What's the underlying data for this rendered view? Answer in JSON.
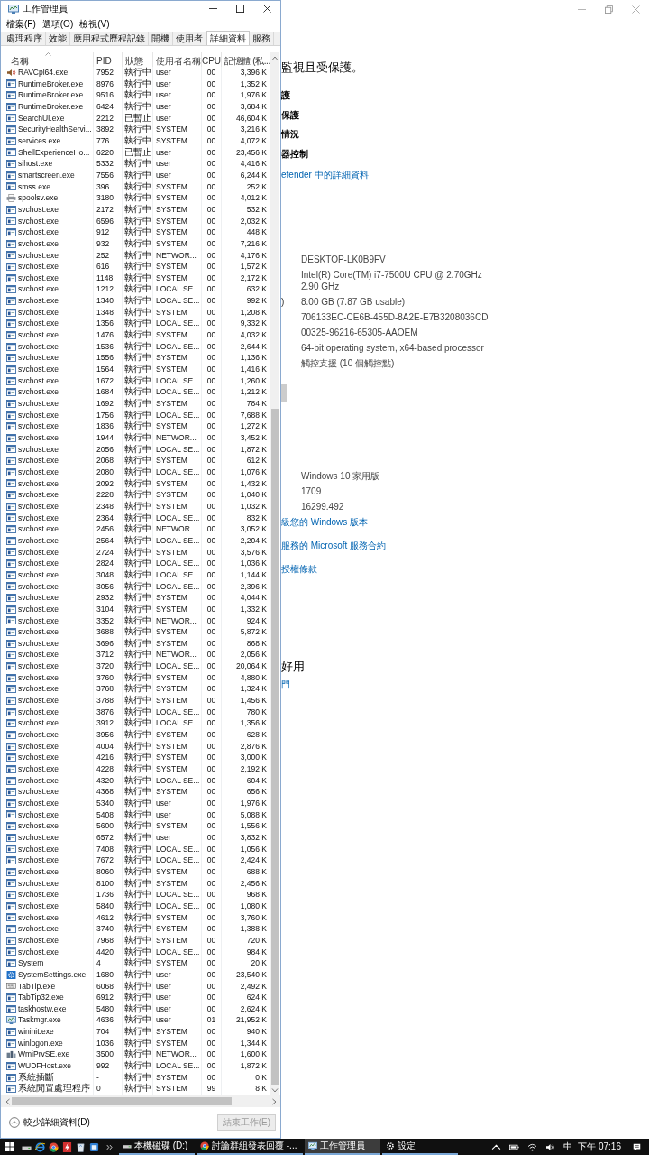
{
  "task_manager": {
    "title": "工作管理員",
    "menu": [
      "檔案(F)",
      "選項(O)",
      "檢視(V)"
    ],
    "tabs": [
      {
        "label": "處理程序",
        "selected": false
      },
      {
        "label": "效能",
        "selected": false
      },
      {
        "label": "應用程式歷程記錄",
        "selected": false
      },
      {
        "label": "開機",
        "selected": false
      },
      {
        "label": "使用者",
        "selected": false
      },
      {
        "label": "詳細資料",
        "selected": true
      },
      {
        "label": "服務",
        "selected": false
      }
    ],
    "columns": [
      "名稱",
      "PID",
      "狀態",
      "使用者名稱",
      "CPU",
      "記憶體 (私..."
    ],
    "rows": [
      {
        "kind": "audio",
        "name": "RAVCpl64.exe",
        "pid": "7952",
        "status": "執行中",
        "user": "user",
        "cpu": "00",
        "memory": "3,396 K"
      },
      {
        "kind": "app",
        "name": "RuntimeBroker.exe",
        "pid": "8976",
        "status": "執行中",
        "user": "user",
        "cpu": "00",
        "memory": "1,352 K"
      },
      {
        "kind": "app",
        "name": "RuntimeBroker.exe",
        "pid": "9516",
        "status": "執行中",
        "user": "user",
        "cpu": "00",
        "memory": "1,976 K"
      },
      {
        "kind": "app",
        "name": "RuntimeBroker.exe",
        "pid": "6424",
        "status": "執行中",
        "user": "user",
        "cpu": "00",
        "memory": "3,684 K"
      },
      {
        "kind": "app",
        "name": "SearchUI.exe",
        "pid": "2212",
        "status": "已暫止",
        "user": "user",
        "cpu": "00",
        "memory": "46,604 K"
      },
      {
        "kind": "app",
        "name": "SecurityHealthServi...",
        "pid": "3892",
        "status": "執行中",
        "user": "SYSTEM",
        "cpu": "00",
        "memory": "3,216 K"
      },
      {
        "kind": "app",
        "name": "services.exe",
        "pid": "776",
        "status": "執行中",
        "user": "SYSTEM",
        "cpu": "00",
        "memory": "4,072 K"
      },
      {
        "kind": "app",
        "name": "ShellExperienceHo...",
        "pid": "6220",
        "status": "已暫止",
        "user": "user",
        "cpu": "00",
        "memory": "23,456 K"
      },
      {
        "kind": "app",
        "name": "sihost.exe",
        "pid": "5332",
        "status": "執行中",
        "user": "user",
        "cpu": "00",
        "memory": "4,416 K"
      },
      {
        "kind": "app",
        "name": "smartscreen.exe",
        "pid": "7556",
        "status": "執行中",
        "user": "user",
        "cpu": "00",
        "memory": "6,244 K"
      },
      {
        "kind": "app",
        "name": "smss.exe",
        "pid": "396",
        "status": "執行中",
        "user": "SYSTEM",
        "cpu": "00",
        "memory": "252 K"
      },
      {
        "kind": "printer",
        "name": "spoolsv.exe",
        "pid": "3180",
        "status": "執行中",
        "user": "SYSTEM",
        "cpu": "00",
        "memory": "4,012 K"
      },
      {
        "kind": "app",
        "name": "svchost.exe",
        "pid": "2172",
        "status": "執行中",
        "user": "SYSTEM",
        "cpu": "00",
        "memory": "532 K"
      },
      {
        "kind": "app",
        "name": "svchost.exe",
        "pid": "6596",
        "status": "執行中",
        "user": "SYSTEM",
        "cpu": "00",
        "memory": "2,032 K"
      },
      {
        "kind": "app",
        "name": "svchost.exe",
        "pid": "912",
        "status": "執行中",
        "user": "SYSTEM",
        "cpu": "00",
        "memory": "448 K"
      },
      {
        "kind": "app",
        "name": "svchost.exe",
        "pid": "932",
        "status": "執行中",
        "user": "SYSTEM",
        "cpu": "00",
        "memory": "7,216 K"
      },
      {
        "kind": "app",
        "name": "svchost.exe",
        "pid": "252",
        "status": "執行中",
        "user": "NETWOR...",
        "cpu": "00",
        "memory": "4,176 K"
      },
      {
        "kind": "app",
        "name": "svchost.exe",
        "pid": "616",
        "status": "執行中",
        "user": "SYSTEM",
        "cpu": "00",
        "memory": "1,572 K"
      },
      {
        "kind": "app",
        "name": "svchost.exe",
        "pid": "1148",
        "status": "執行中",
        "user": "SYSTEM",
        "cpu": "00",
        "memory": "2,172 K"
      },
      {
        "kind": "app",
        "name": "svchost.exe",
        "pid": "1212",
        "status": "執行中",
        "user": "LOCAL SE...",
        "cpu": "00",
        "memory": "632 K"
      },
      {
        "kind": "app",
        "name": "svchost.exe",
        "pid": "1340",
        "status": "執行中",
        "user": "LOCAL SE...",
        "cpu": "00",
        "memory": "992 K"
      },
      {
        "kind": "app",
        "name": "svchost.exe",
        "pid": "1348",
        "status": "執行中",
        "user": "SYSTEM",
        "cpu": "00",
        "memory": "1,208 K"
      },
      {
        "kind": "app",
        "name": "svchost.exe",
        "pid": "1356",
        "status": "執行中",
        "user": "LOCAL SE...",
        "cpu": "00",
        "memory": "9,332 K"
      },
      {
        "kind": "app",
        "name": "svchost.exe",
        "pid": "1476",
        "status": "執行中",
        "user": "SYSTEM",
        "cpu": "00",
        "memory": "4,032 K"
      },
      {
        "kind": "app",
        "name": "svchost.exe",
        "pid": "1536",
        "status": "執行中",
        "user": "LOCAL SE...",
        "cpu": "00",
        "memory": "2,644 K"
      },
      {
        "kind": "app",
        "name": "svchost.exe",
        "pid": "1556",
        "status": "執行中",
        "user": "SYSTEM",
        "cpu": "00",
        "memory": "1,136 K"
      },
      {
        "kind": "app",
        "name": "svchost.exe",
        "pid": "1564",
        "status": "執行中",
        "user": "SYSTEM",
        "cpu": "00",
        "memory": "1,416 K"
      },
      {
        "kind": "app",
        "name": "svchost.exe",
        "pid": "1672",
        "status": "執行中",
        "user": "LOCAL SE...",
        "cpu": "00",
        "memory": "1,260 K"
      },
      {
        "kind": "app",
        "name": "svchost.exe",
        "pid": "1684",
        "status": "執行中",
        "user": "LOCAL SE...",
        "cpu": "00",
        "memory": "1,212 K"
      },
      {
        "kind": "app",
        "name": "svchost.exe",
        "pid": "1692",
        "status": "執行中",
        "user": "SYSTEM",
        "cpu": "00",
        "memory": "784 K"
      },
      {
        "kind": "app",
        "name": "svchost.exe",
        "pid": "1756",
        "status": "執行中",
        "user": "LOCAL SE...",
        "cpu": "00",
        "memory": "7,688 K"
      },
      {
        "kind": "app",
        "name": "svchost.exe",
        "pid": "1836",
        "status": "執行中",
        "user": "SYSTEM",
        "cpu": "00",
        "memory": "1,272 K"
      },
      {
        "kind": "app",
        "name": "svchost.exe",
        "pid": "1944",
        "status": "執行中",
        "user": "NETWOR...",
        "cpu": "00",
        "memory": "3,452 K"
      },
      {
        "kind": "app",
        "name": "svchost.exe",
        "pid": "2056",
        "status": "執行中",
        "user": "LOCAL SE...",
        "cpu": "00",
        "memory": "1,872 K"
      },
      {
        "kind": "app",
        "name": "svchost.exe",
        "pid": "2068",
        "status": "執行中",
        "user": "SYSTEM",
        "cpu": "00",
        "memory": "612 K"
      },
      {
        "kind": "app",
        "name": "svchost.exe",
        "pid": "2080",
        "status": "執行中",
        "user": "LOCAL SE...",
        "cpu": "00",
        "memory": "1,076 K"
      },
      {
        "kind": "app",
        "name": "svchost.exe",
        "pid": "2092",
        "status": "執行中",
        "user": "SYSTEM",
        "cpu": "00",
        "memory": "1,432 K"
      },
      {
        "kind": "app",
        "name": "svchost.exe",
        "pid": "2228",
        "status": "執行中",
        "user": "SYSTEM",
        "cpu": "00",
        "memory": "1,040 K"
      },
      {
        "kind": "app",
        "name": "svchost.exe",
        "pid": "2348",
        "status": "執行中",
        "user": "SYSTEM",
        "cpu": "00",
        "memory": "1,032 K"
      },
      {
        "kind": "app",
        "name": "svchost.exe",
        "pid": "2364",
        "status": "執行中",
        "user": "LOCAL SE...",
        "cpu": "00",
        "memory": "832 K"
      },
      {
        "kind": "app",
        "name": "svchost.exe",
        "pid": "2456",
        "status": "執行中",
        "user": "NETWOR...",
        "cpu": "00",
        "memory": "3,052 K"
      },
      {
        "kind": "app",
        "name": "svchost.exe",
        "pid": "2564",
        "status": "執行中",
        "user": "LOCAL SE...",
        "cpu": "00",
        "memory": "2,204 K"
      },
      {
        "kind": "app",
        "name": "svchost.exe",
        "pid": "2724",
        "status": "執行中",
        "user": "SYSTEM",
        "cpu": "00",
        "memory": "3,576 K"
      },
      {
        "kind": "app",
        "name": "svchost.exe",
        "pid": "2824",
        "status": "執行中",
        "user": "LOCAL SE...",
        "cpu": "00",
        "memory": "1,036 K"
      },
      {
        "kind": "app",
        "name": "svchost.exe",
        "pid": "3048",
        "status": "執行中",
        "user": "LOCAL SE...",
        "cpu": "00",
        "memory": "1,144 K"
      },
      {
        "kind": "app",
        "name": "svchost.exe",
        "pid": "3056",
        "status": "執行中",
        "user": "LOCAL SE...",
        "cpu": "00",
        "memory": "2,396 K"
      },
      {
        "kind": "app",
        "name": "svchost.exe",
        "pid": "2932",
        "status": "執行中",
        "user": "SYSTEM",
        "cpu": "00",
        "memory": "4,044 K"
      },
      {
        "kind": "app",
        "name": "svchost.exe",
        "pid": "3104",
        "status": "執行中",
        "user": "SYSTEM",
        "cpu": "00",
        "memory": "1,332 K"
      },
      {
        "kind": "app",
        "name": "svchost.exe",
        "pid": "3352",
        "status": "執行中",
        "user": "NETWOR...",
        "cpu": "00",
        "memory": "924 K"
      },
      {
        "kind": "app",
        "name": "svchost.exe",
        "pid": "3688",
        "status": "執行中",
        "user": "SYSTEM",
        "cpu": "00",
        "memory": "5,872 K"
      },
      {
        "kind": "app",
        "name": "svchost.exe",
        "pid": "3696",
        "status": "執行中",
        "user": "SYSTEM",
        "cpu": "00",
        "memory": "868 K"
      },
      {
        "kind": "app",
        "name": "svchost.exe",
        "pid": "3712",
        "status": "執行中",
        "user": "NETWOR...",
        "cpu": "00",
        "memory": "2,056 K"
      },
      {
        "kind": "app",
        "name": "svchost.exe",
        "pid": "3720",
        "status": "執行中",
        "user": "LOCAL SE...",
        "cpu": "00",
        "memory": "20,064 K"
      },
      {
        "kind": "app",
        "name": "svchost.exe",
        "pid": "3760",
        "status": "執行中",
        "user": "SYSTEM",
        "cpu": "00",
        "memory": "4,880 K"
      },
      {
        "kind": "app",
        "name": "svchost.exe",
        "pid": "3768",
        "status": "執行中",
        "user": "SYSTEM",
        "cpu": "00",
        "memory": "1,324 K"
      },
      {
        "kind": "app",
        "name": "svchost.exe",
        "pid": "3788",
        "status": "執行中",
        "user": "SYSTEM",
        "cpu": "00",
        "memory": "1,456 K"
      },
      {
        "kind": "app",
        "name": "svchost.exe",
        "pid": "3876",
        "status": "執行中",
        "user": "LOCAL SE...",
        "cpu": "00",
        "memory": "780 K"
      },
      {
        "kind": "app",
        "name": "svchost.exe",
        "pid": "3912",
        "status": "執行中",
        "user": "LOCAL SE...",
        "cpu": "00",
        "memory": "1,356 K"
      },
      {
        "kind": "app",
        "name": "svchost.exe",
        "pid": "3956",
        "status": "執行中",
        "user": "SYSTEM",
        "cpu": "00",
        "memory": "628 K"
      },
      {
        "kind": "app",
        "name": "svchost.exe",
        "pid": "4004",
        "status": "執行中",
        "user": "SYSTEM",
        "cpu": "00",
        "memory": "2,876 K"
      },
      {
        "kind": "app",
        "name": "svchost.exe",
        "pid": "4216",
        "status": "執行中",
        "user": "SYSTEM",
        "cpu": "00",
        "memory": "3,000 K"
      },
      {
        "kind": "app",
        "name": "svchost.exe",
        "pid": "4228",
        "status": "執行中",
        "user": "SYSTEM",
        "cpu": "00",
        "memory": "2,192 K"
      },
      {
        "kind": "app",
        "name": "svchost.exe",
        "pid": "4320",
        "status": "執行中",
        "user": "LOCAL SE...",
        "cpu": "00",
        "memory": "604 K"
      },
      {
        "kind": "app",
        "name": "svchost.exe",
        "pid": "4368",
        "status": "執行中",
        "user": "SYSTEM",
        "cpu": "00",
        "memory": "656 K"
      },
      {
        "kind": "app",
        "name": "svchost.exe",
        "pid": "5340",
        "status": "執行中",
        "user": "user",
        "cpu": "00",
        "memory": "1,976 K"
      },
      {
        "kind": "app",
        "name": "svchost.exe",
        "pid": "5408",
        "status": "執行中",
        "user": "user",
        "cpu": "00",
        "memory": "5,088 K"
      },
      {
        "kind": "app",
        "name": "svchost.exe",
        "pid": "5600",
        "status": "執行中",
        "user": "SYSTEM",
        "cpu": "00",
        "memory": "1,556 K"
      },
      {
        "kind": "app",
        "name": "svchost.exe",
        "pid": "6572",
        "status": "執行中",
        "user": "user",
        "cpu": "00",
        "memory": "3,832 K"
      },
      {
        "kind": "app",
        "name": "svchost.exe",
        "pid": "7408",
        "status": "執行中",
        "user": "LOCAL SE...",
        "cpu": "00",
        "memory": "1,056 K"
      },
      {
        "kind": "app",
        "name": "svchost.exe",
        "pid": "7672",
        "status": "執行中",
        "user": "LOCAL SE...",
        "cpu": "00",
        "memory": "2,424 K"
      },
      {
        "kind": "app",
        "name": "svchost.exe",
        "pid": "8060",
        "status": "執行中",
        "user": "SYSTEM",
        "cpu": "00",
        "memory": "688 K"
      },
      {
        "kind": "app",
        "name": "svchost.exe",
        "pid": "8100",
        "status": "執行中",
        "user": "SYSTEM",
        "cpu": "00",
        "memory": "2,456 K"
      },
      {
        "kind": "app",
        "name": "svchost.exe",
        "pid": "1736",
        "status": "執行中",
        "user": "LOCAL SE...",
        "cpu": "00",
        "memory": "968 K"
      },
      {
        "kind": "app",
        "name": "svchost.exe",
        "pid": "5840",
        "status": "執行中",
        "user": "LOCAL SE...",
        "cpu": "00",
        "memory": "1,080 K"
      },
      {
        "kind": "app",
        "name": "svchost.exe",
        "pid": "4612",
        "status": "執行中",
        "user": "SYSTEM",
        "cpu": "00",
        "memory": "3,760 K"
      },
      {
        "kind": "app",
        "name": "svchost.exe",
        "pid": "3740",
        "status": "執行中",
        "user": "SYSTEM",
        "cpu": "00",
        "memory": "1,388 K"
      },
      {
        "kind": "app",
        "name": "svchost.exe",
        "pid": "7968",
        "status": "執行中",
        "user": "SYSTEM",
        "cpu": "00",
        "memory": "720 K"
      },
      {
        "kind": "app",
        "name": "svchost.exe",
        "pid": "4420",
        "status": "執行中",
        "user": "LOCAL SE...",
        "cpu": "00",
        "memory": "984 K"
      },
      {
        "kind": "app",
        "name": "System",
        "pid": "4",
        "status": "執行中",
        "user": "SYSTEM",
        "cpu": "00",
        "memory": "20 K"
      },
      {
        "kind": "settings",
        "name": "SystemSettings.exe",
        "pid": "1680",
        "status": "執行中",
        "user": "user",
        "cpu": "00",
        "memory": "23,540 K"
      },
      {
        "kind": "keyboard",
        "name": "TabTip.exe",
        "pid": "6068",
        "status": "執行中",
        "user": "user",
        "cpu": "00",
        "memory": "2,492 K"
      },
      {
        "kind": "app",
        "name": "TabTip32.exe",
        "pid": "6912",
        "status": "執行中",
        "user": "user",
        "cpu": "00",
        "memory": "624 K"
      },
      {
        "kind": "app",
        "name": "taskhostw.exe",
        "pid": "5480",
        "status": "執行中",
        "user": "user",
        "cpu": "00",
        "memory": "2,624 K"
      },
      {
        "kind": "monitor",
        "name": "Taskmgr.exe",
        "pid": "4636",
        "status": "執行中",
        "user": "user",
        "cpu": "01",
        "memory": "21,952 K"
      },
      {
        "kind": "app",
        "name": "wininit.exe",
        "pid": "704",
        "status": "執行中",
        "user": "SYSTEM",
        "cpu": "00",
        "memory": "940 K"
      },
      {
        "kind": "app",
        "name": "winlogon.exe",
        "pid": "1036",
        "status": "執行中",
        "user": "SYSTEM",
        "cpu": "00",
        "memory": "1,344 K"
      },
      {
        "kind": "wmi",
        "name": "WmiPrvSE.exe",
        "pid": "3500",
        "status": "執行中",
        "user": "NETWOR...",
        "cpu": "00",
        "memory": "1,600 K"
      },
      {
        "kind": "app",
        "name": "WUDFHost.exe",
        "pid": "992",
        "status": "執行中",
        "user": "LOCAL SE...",
        "cpu": "00",
        "memory": "1,872 K"
      },
      {
        "kind": "system",
        "name": "系統插斷",
        "pid": "-",
        "status": "執行中",
        "user": "SYSTEM",
        "cpu": "00",
        "memory": "0 K"
      },
      {
        "kind": "system",
        "name": "系統閒置處理程序",
        "pid": "0",
        "status": "執行中",
        "user": "SYSTEM",
        "cpu": "99",
        "memory": "8 K"
      }
    ],
    "footer": {
      "toggle": "較少詳細資料(D)",
      "end_task": {
        "label": "結束工作(E)",
        "disabled": true
      }
    }
  },
  "settings_window": {
    "protection": {
      "heading": "監視且受保護。",
      "items": [
        "護",
        "保護",
        "情況",
        "器控制"
      ],
      "link": "efender 中的詳細資料"
    },
    "device_specs": [
      {
        "value": "DESKTOP-LK0B9FV"
      },
      {
        "value": "Intel(R) Core(TM) i7-7500U CPU @ 2.70GHz 2.90 GHz"
      },
      {
        "label": ")",
        "value": "8.00 GB (7.87 GB usable)"
      },
      {
        "value": "706133EC-CE6B-455D-8A2E-E7B3208036CD"
      },
      {
        "value": "00325-96216-65305-AAOEM"
      },
      {
        "value": "64-bit operating system, x64-based processor"
      },
      {
        "value": "觸控支援 (10 個觸控點)"
      }
    ],
    "windows_specs": [
      {
        "value": "Windows 10 家用版"
      },
      {
        "value": "1709"
      },
      {
        "value": "16299.492"
      }
    ],
    "links": [
      "級您的 Windows 版本",
      "服務的 Microsoft 服務合約",
      "授權條款"
    ],
    "help": {
      "heading": "好用",
      "link": "門"
    }
  },
  "taskbar": {
    "tasks": [
      {
        "kind": "drive",
        "label": "本機磁碟 (D:)",
        "active": false
      },
      {
        "kind": "browser",
        "label": "討論群組發表回覆 -...",
        "active": false
      },
      {
        "kind": "monitor",
        "label": "工作管理員",
        "active": true
      },
      {
        "kind": "settings",
        "label": "設定",
        "active": false
      }
    ],
    "ime": "中",
    "clock": "下午 07:16"
  }
}
